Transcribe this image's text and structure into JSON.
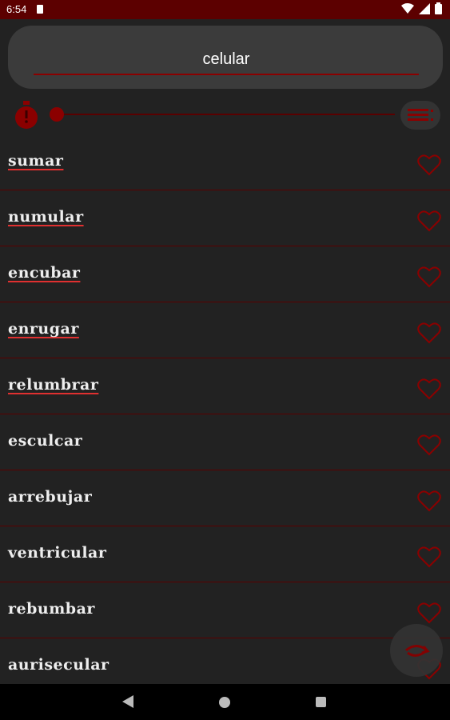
{
  "status_bar": {
    "time": "6:54"
  },
  "search": {
    "value": "celular",
    "placeholder": ""
  },
  "words": [
    {
      "text": "sumar",
      "linked": true
    },
    {
      "text": "numular",
      "linked": true
    },
    {
      "text": "encubar",
      "linked": true
    },
    {
      "text": "enrugar",
      "linked": true
    },
    {
      "text": "relumbrar",
      "linked": true
    },
    {
      "text": "esculcar",
      "linked": false
    },
    {
      "text": "arrebujar",
      "linked": false
    },
    {
      "text": "ventricular",
      "linked": false
    },
    {
      "text": "rebumbar",
      "linked": false
    },
    {
      "text": "aurisecular",
      "linked": false
    }
  ],
  "slider": {
    "value_fraction": 0.0
  },
  "colors": {
    "accent": "#8b0000",
    "background": "#222222",
    "status_bar": "#5c0000"
  }
}
